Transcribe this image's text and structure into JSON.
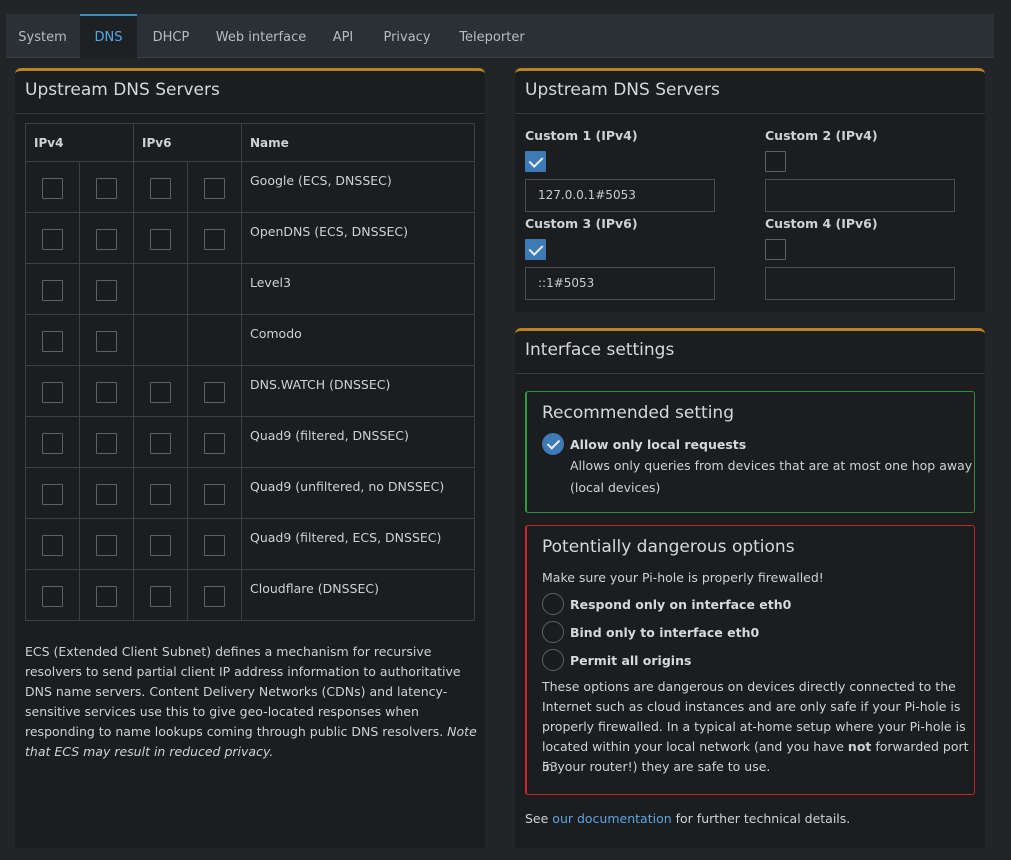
{
  "tabs": [
    "System",
    "DNS",
    "DHCP",
    "Web interface",
    "API",
    "Privacy",
    "Teleporter"
  ],
  "active_tab": "DNS",
  "left_panel": {
    "title": "Upstream DNS Servers",
    "headers": {
      "ipv4": "IPv4",
      "ipv6": "IPv6",
      "name": "Name"
    },
    "servers": [
      {
        "name": "Google (ECS, DNSSEC)",
        "ipv4": [
          false,
          false
        ],
        "ipv6": [
          false,
          false
        ]
      },
      {
        "name": "OpenDNS (ECS, DNSSEC)",
        "ipv4": [
          false,
          false
        ],
        "ipv6": [
          false,
          false
        ]
      },
      {
        "name": "Level3",
        "ipv4": [
          false,
          false
        ],
        "ipv6": null
      },
      {
        "name": "Comodo",
        "ipv4": [
          false,
          false
        ],
        "ipv6": null
      },
      {
        "name": "DNS.WATCH (DNSSEC)",
        "ipv4": [
          false,
          false
        ],
        "ipv6": [
          false,
          false
        ]
      },
      {
        "name": "Quad9 (filtered, DNSSEC)",
        "ipv4": [
          false,
          false
        ],
        "ipv6": [
          false,
          false
        ]
      },
      {
        "name": "Quad9 (unfiltered, no DNSSEC)",
        "ipv4": [
          false,
          false
        ],
        "ipv6": [
          false,
          false
        ]
      },
      {
        "name": "Quad9 (filtered, ECS, DNSSEC)",
        "ipv4": [
          false,
          false
        ],
        "ipv6": [
          false,
          false
        ]
      },
      {
        "name": "Cloudflare (DNSSEC)",
        "ipv4": [
          false,
          false
        ],
        "ipv6": [
          false,
          false
        ]
      }
    ],
    "ecs_text": "ECS (Extended Client Subnet) defines a mechanism for recursive resolvers to send partial client IP address information to authoritative DNS name servers. Content Delivery Networks (CDNs) and latency-sensitive services use this to give geo-located responses when responding to name lookups coming through public DNS resolvers.",
    "ecs_note": "Note that ECS may result in reduced privacy."
  },
  "custom_panel": {
    "title": "Upstream DNS Servers",
    "custom1": {
      "label": "Custom 1 (IPv4)",
      "checked": true,
      "value": "127.0.0.1#5053"
    },
    "custom2": {
      "label": "Custom 2 (IPv4)",
      "checked": false,
      "value": ""
    },
    "custom3": {
      "label": "Custom 3 (IPv6)",
      "checked": true,
      "value": "::1#5053"
    },
    "custom4": {
      "label": "Custom 4 (IPv6)",
      "checked": false,
      "value": ""
    }
  },
  "interface_panel": {
    "title": "Interface settings",
    "recommended": {
      "title": "Recommended setting",
      "option_label": "Allow only local requests",
      "option_desc_1": "Allows only queries from devices that are at most one hop away",
      "option_desc_2": "(local devices)"
    },
    "dangerous": {
      "title": "Potentially dangerous options",
      "warning": "Make sure your Pi-hole is properly firewalled!",
      "options": [
        "Respond only on interface eth0",
        "Bind only to interface eth0",
        "Permit all origins"
      ],
      "desc_1": "These options are dangerous on devices directly connected to the",
      "desc_2": "Internet such as cloud instances and are only safe if your Pi-hole is",
      "desc_3": "properly firewalled. In a typical at-home setup where your Pi-hole is",
      "desc_4a": "located within your local network (and you have ",
      "desc_4b": "not",
      "desc_4c": " forwarded port 53",
      "desc_5": "in your router!) they are safe to use."
    },
    "footer_pre": "See ",
    "footer_link": "our documentation",
    "footer_post": " for further technical details."
  }
}
